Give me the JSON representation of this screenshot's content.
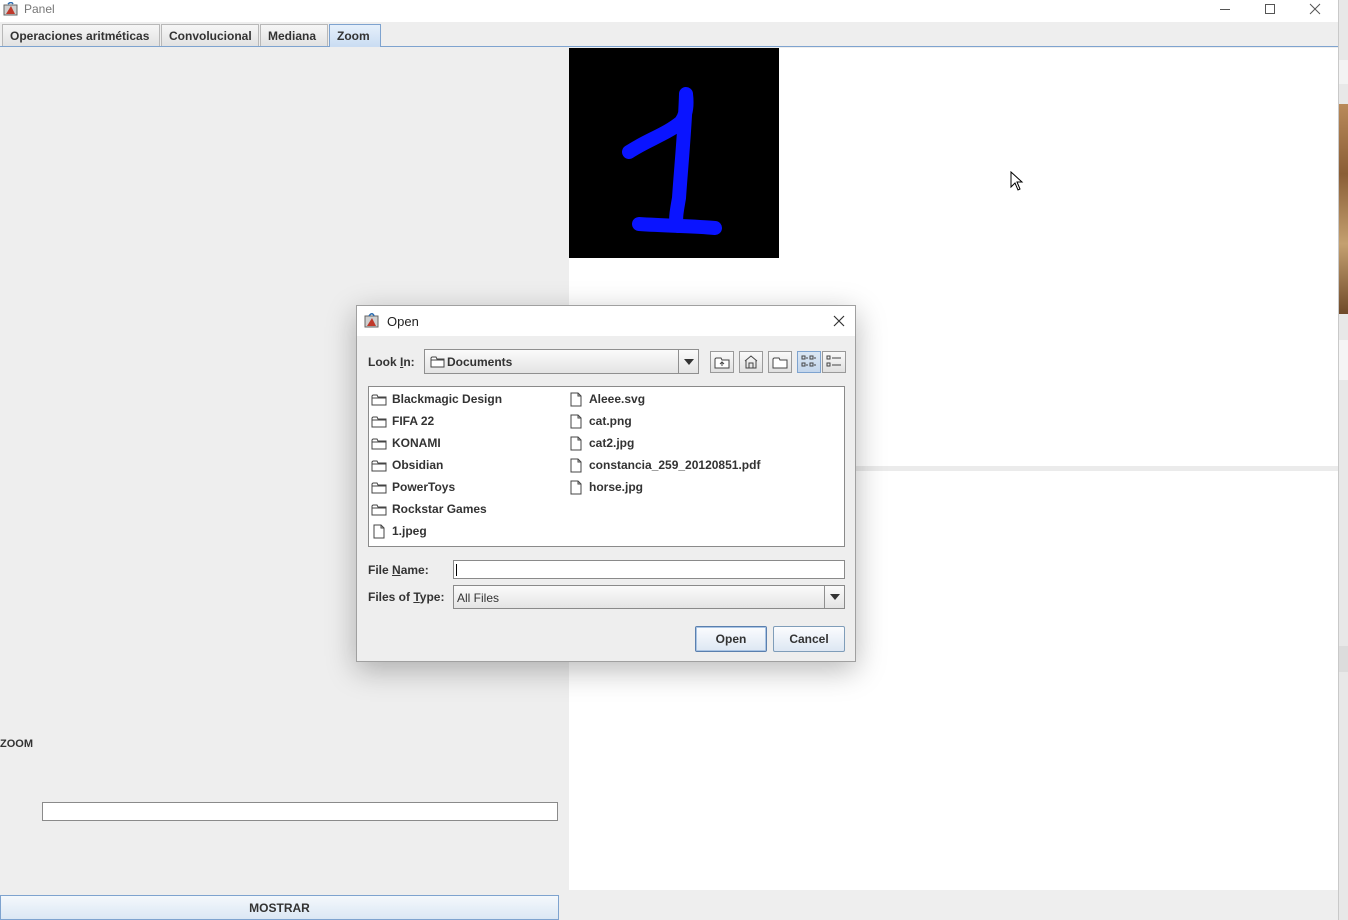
{
  "window": {
    "title": "Panel",
    "controls": [
      "minimize-icon",
      "maximize-icon",
      "close-icon"
    ]
  },
  "tabs": [
    {
      "label": "Operaciones aritméticas",
      "selected": false
    },
    {
      "label": "Convolucional",
      "selected": false
    },
    {
      "label": "Mediana",
      "selected": false
    },
    {
      "label": "Zoom",
      "selected": true
    }
  ],
  "left_panel": {
    "zoom_label": "ZOOM",
    "zoom_input_value": "",
    "mostrar_button": "MOSTRAR"
  },
  "preview": {
    "glyph": "1",
    "glyph_color": "#0a14ff",
    "background": "#000000"
  },
  "dialog": {
    "title": "Open",
    "look_in_label_pre": "Look ",
    "look_in_label_mnemonic": "I",
    "look_in_label_post": "n:",
    "look_in_value": "Documents",
    "toolbar": [
      "up-one-level-icon",
      "home-icon",
      "new-folder-icon",
      "list-view-icon",
      "details-view-icon"
    ],
    "view_mode": "list",
    "files_column_1": [
      {
        "name": "Blackmagic Design",
        "type": "folder"
      },
      {
        "name": "FIFA 22",
        "type": "folder"
      },
      {
        "name": "KONAMI",
        "type": "folder"
      },
      {
        "name": "Obsidian",
        "type": "folder"
      },
      {
        "name": "PowerToys",
        "type": "folder"
      },
      {
        "name": "Rockstar Games",
        "type": "folder"
      },
      {
        "name": "1.jpeg",
        "type": "file"
      }
    ],
    "files_column_2": [
      {
        "name": "Aleee.svg",
        "type": "file"
      },
      {
        "name": "cat.png",
        "type": "file"
      },
      {
        "name": "cat2.jpg",
        "type": "file"
      },
      {
        "name": "constancia_259_20120851.pdf",
        "type": "file"
      },
      {
        "name": "horse.jpg",
        "type": "file"
      }
    ],
    "file_name_label_pre": "File ",
    "file_name_label_mnemonic": "N",
    "file_name_label_post": "ame:",
    "file_name_value": "",
    "files_of_type_label_pre": "Files of ",
    "files_of_type_label_mnemonic": "T",
    "files_of_type_label_post": "ype:",
    "files_of_type_value": "All Files",
    "open_button": "Open",
    "cancel_button": "Cancel"
  }
}
